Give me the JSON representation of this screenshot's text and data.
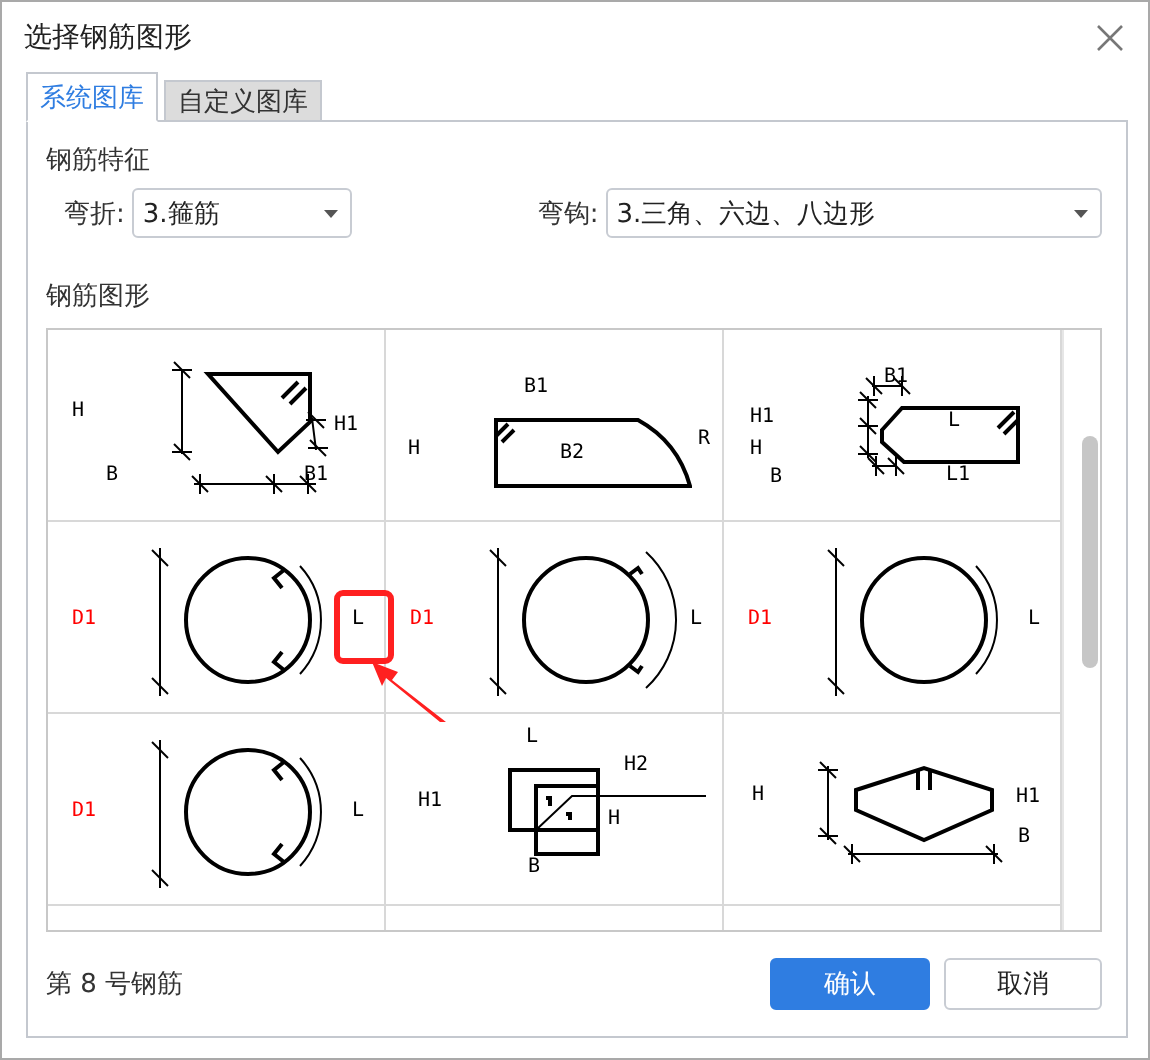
{
  "window": {
    "title": "选择钢筋图形"
  },
  "tabs": [
    {
      "label": "系统图库",
      "selected": true
    },
    {
      "label": "自定义图库",
      "selected": false
    }
  ],
  "features": {
    "heading": "钢筋特征",
    "fields": [
      {
        "label": "弯折:",
        "value": "3.箍筋"
      },
      {
        "label": "弯钩:",
        "value": "3.三角、六边、八边形"
      }
    ]
  },
  "shapes": {
    "heading": "钢筋图形",
    "cells": [
      {
        "kind": "triangle",
        "labels": [
          {
            "text": "H",
            "color": "#000000"
          },
          {
            "text": "B",
            "color": "#000000"
          },
          {
            "text": "H1",
            "color": "#000000"
          },
          {
            "text": "B1",
            "color": "#000000"
          }
        ]
      },
      {
        "kind": "arc-end",
        "labels": [
          {
            "text": "B1",
            "color": "#000000"
          },
          {
            "text": "H",
            "color": "#000000"
          },
          {
            "text": "B2",
            "color": "#000000"
          },
          {
            "text": "R",
            "color": "#000000"
          }
        ]
      },
      {
        "kind": "pointed-end",
        "labels": [
          {
            "text": "B1",
            "color": "#000000"
          },
          {
            "text": "H1",
            "color": "#000000"
          },
          {
            "text": "H",
            "color": "#000000"
          },
          {
            "text": "B",
            "color": "#000000"
          },
          {
            "text": "L",
            "color": "#000000"
          },
          {
            "text": "L1",
            "color": "#000000"
          }
        ]
      },
      {
        "kind": "circle-hooks-in",
        "labels": [
          {
            "text": "D1",
            "color": "#ff0000"
          },
          {
            "text": "L",
            "color": "#000000"
          }
        ]
      },
      {
        "kind": "circle-hooks-out",
        "labels": [
          {
            "text": "D1",
            "color": "#ff0000"
          },
          {
            "text": "L",
            "color": "#000000"
          }
        ]
      },
      {
        "kind": "circle-plain",
        "labels": [
          {
            "text": "D1",
            "color": "#ff0000"
          },
          {
            "text": "L",
            "color": "#000000"
          }
        ]
      },
      {
        "kind": "circle-hooks-in",
        "labels": [
          {
            "text": "D1",
            "color": "#ff0000"
          },
          {
            "text": "L",
            "color": "#000000"
          }
        ]
      },
      {
        "kind": "double-square",
        "labels": [
          {
            "text": "L",
            "color": "#000000"
          },
          {
            "text": "H1",
            "color": "#000000"
          },
          {
            "text": "H2",
            "color": "#000000"
          },
          {
            "text": "H",
            "color": "#000000"
          },
          {
            "text": "B",
            "color": "#000000"
          }
        ]
      },
      {
        "kind": "hexagon",
        "labels": [
          {
            "text": "H",
            "color": "#000000"
          },
          {
            "text": "H1",
            "color": "#000000"
          },
          {
            "text": "B",
            "color": "#000000"
          }
        ]
      }
    ]
  },
  "footer": {
    "status": "第 8 号钢筋"
  },
  "buttons": [
    {
      "label": "确认",
      "kind": "primary"
    },
    {
      "label": "取消",
      "kind": "secondary"
    }
  ]
}
